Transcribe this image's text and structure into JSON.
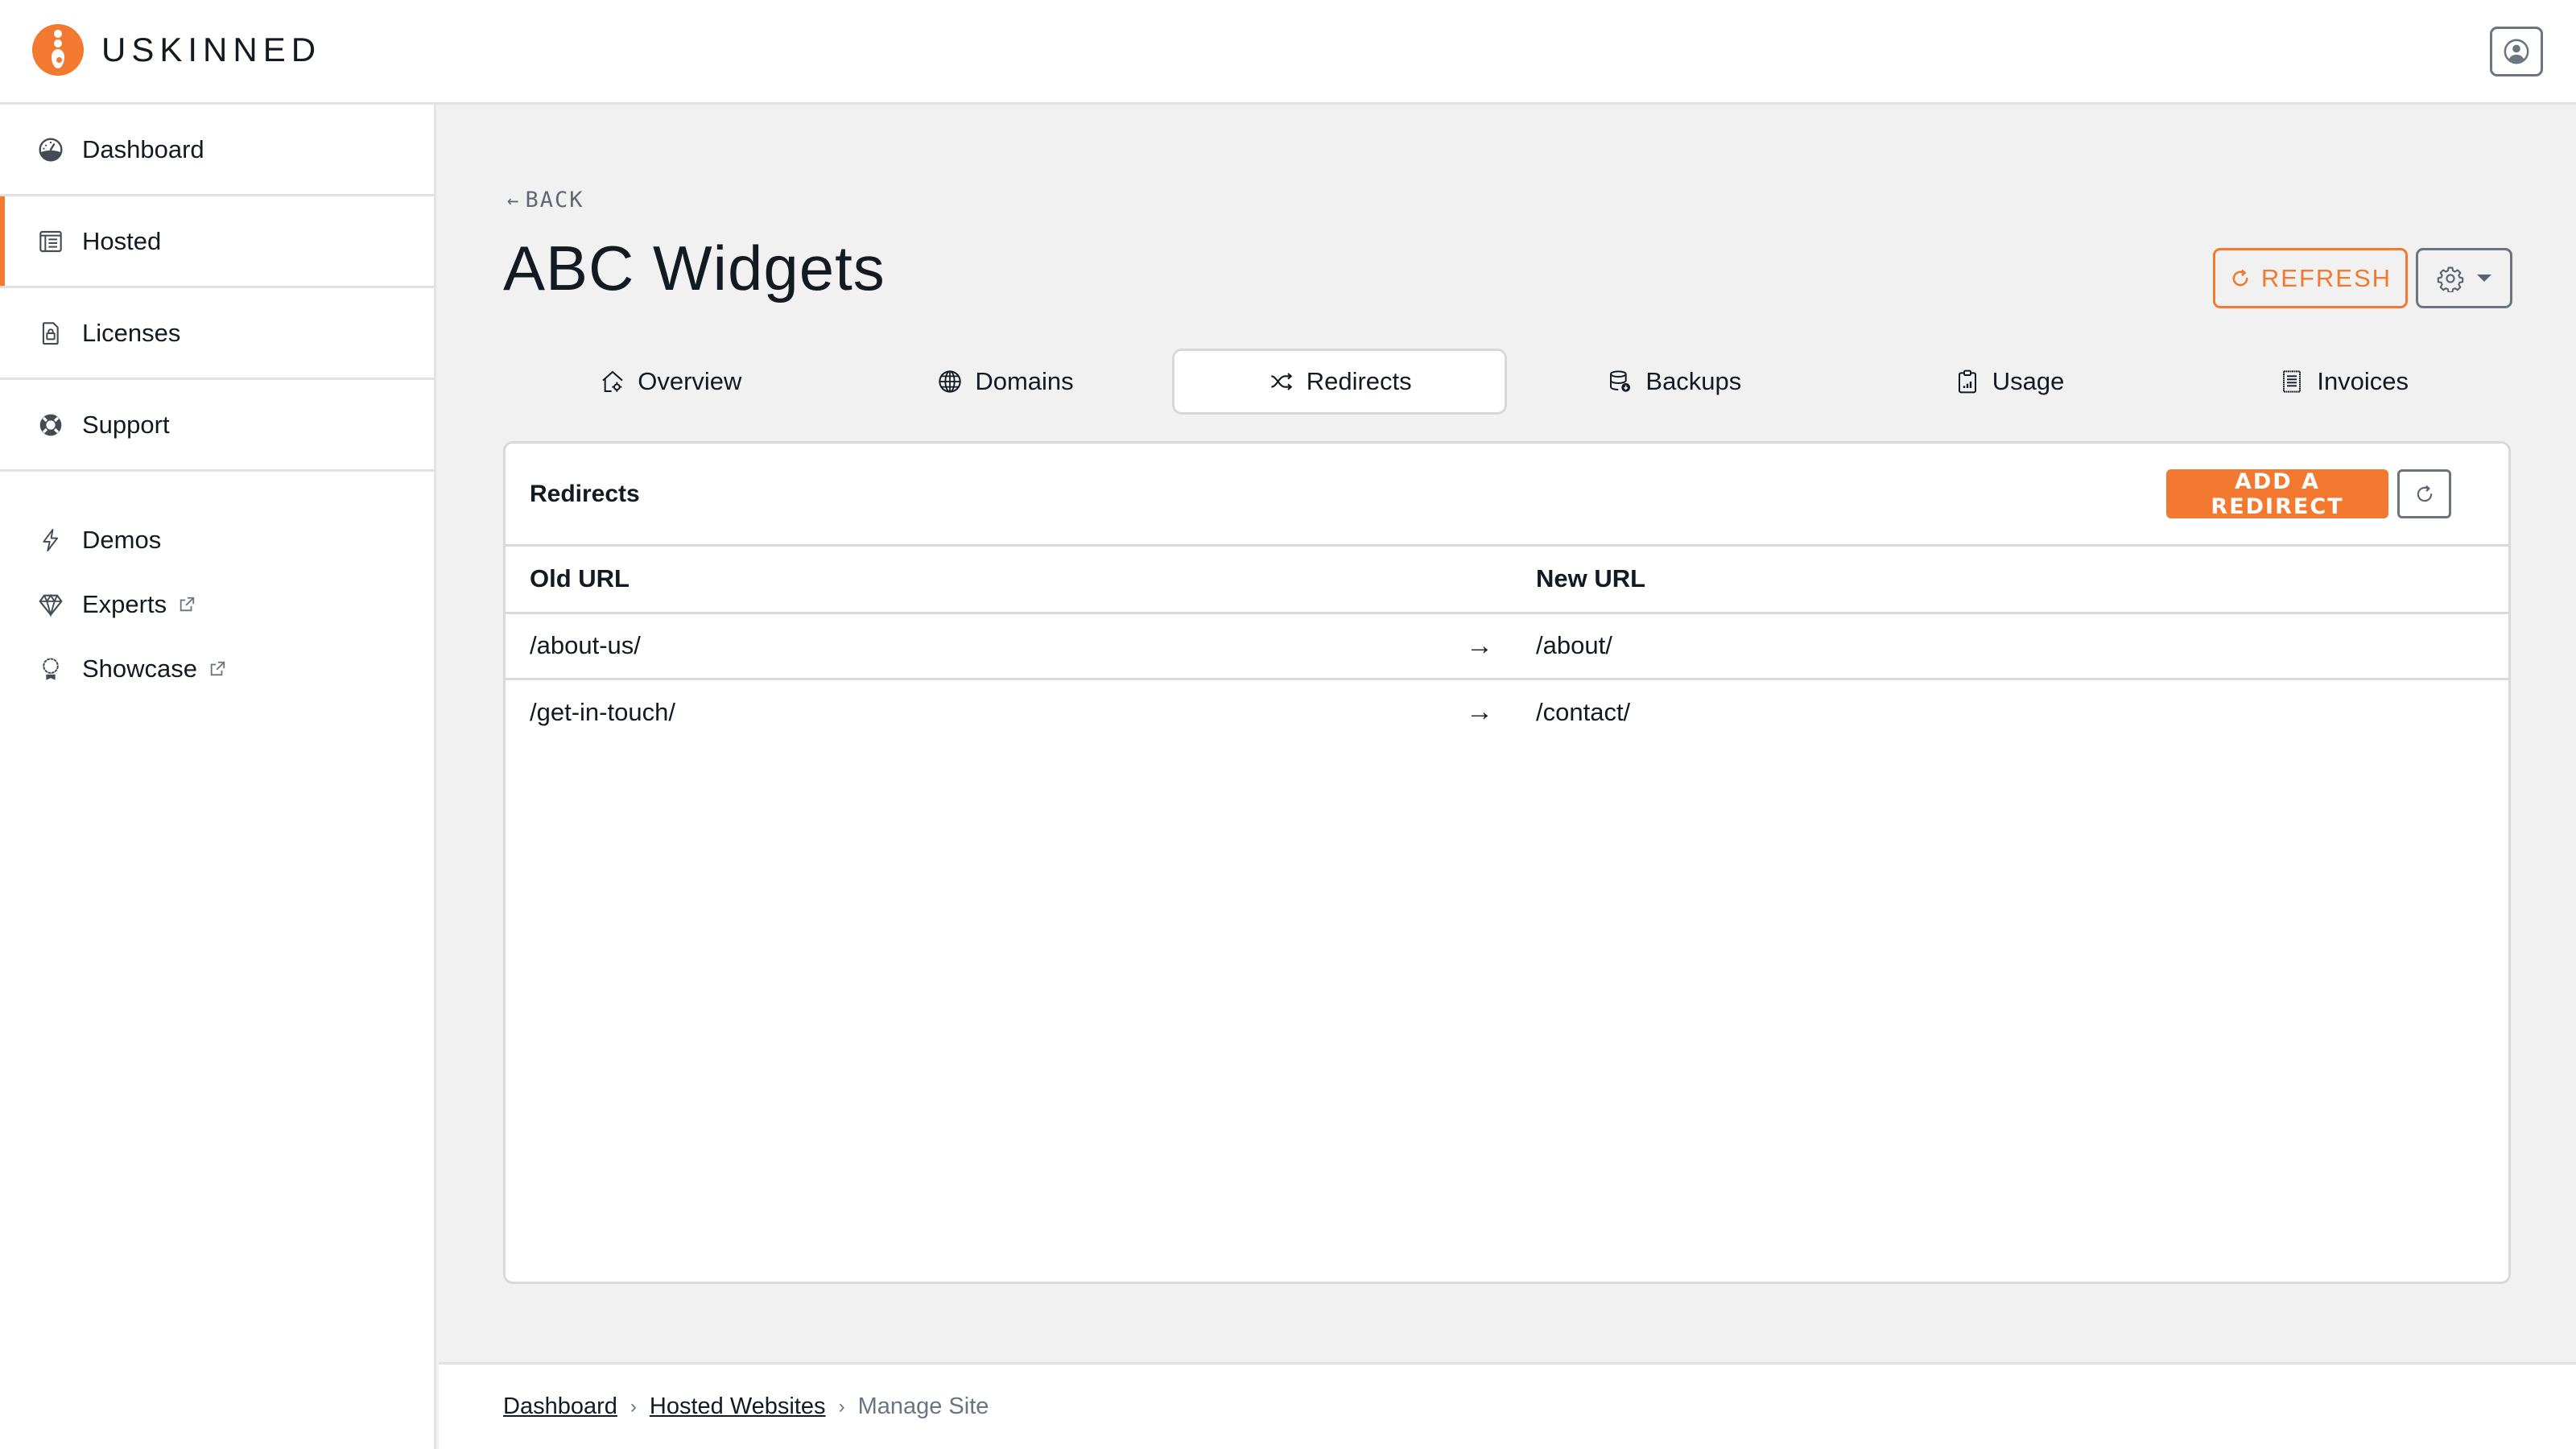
{
  "brand": {
    "name": "USKINNED",
    "accent_color": "#f2792f"
  },
  "header": {
    "account_icon": "user-circle-icon"
  },
  "sidebar": {
    "primary": [
      {
        "label": "Dashboard",
        "icon": "gauge-icon",
        "active": false
      },
      {
        "label": "Hosted",
        "icon": "hosted-list-icon",
        "active": true
      },
      {
        "label": "Licenses",
        "icon": "license-lock-icon",
        "active": false
      },
      {
        "label": "Support",
        "icon": "lifebuoy-icon",
        "active": false
      }
    ],
    "secondary": [
      {
        "label": "Demos",
        "icon": "lightning-icon",
        "external": false
      },
      {
        "label": "Experts",
        "icon": "diamond-icon",
        "external": true
      },
      {
        "label": "Showcase",
        "icon": "award-icon",
        "external": true
      }
    ]
  },
  "page": {
    "back_label": "BACK",
    "title": "ABC Widgets",
    "refresh_label": "REFRESH",
    "tabs": [
      {
        "label": "Overview",
        "icon": "home-gear-icon",
        "active": false
      },
      {
        "label": "Domains",
        "icon": "globe-icon",
        "active": false
      },
      {
        "label": "Redirects",
        "icon": "shuffle-icon",
        "active": true
      },
      {
        "label": "Backups",
        "icon": "database-icon",
        "active": false
      },
      {
        "label": "Usage",
        "icon": "clipboard-chart-icon",
        "active": false
      },
      {
        "label": "Invoices",
        "icon": "receipt-icon",
        "active": false
      }
    ]
  },
  "redirects": {
    "title": "Redirects",
    "add_label": "ADD A REDIRECT",
    "columns": {
      "old": "Old URL",
      "new": "New URL"
    },
    "arrow": "→",
    "rows": [
      {
        "old": "/about-us/",
        "new": "/about/"
      },
      {
        "old": "/get-in-touch/",
        "new": "/contact/"
      }
    ]
  },
  "breadcrumb": {
    "items": [
      {
        "label": "Dashboard",
        "link": true
      },
      {
        "label": "Hosted Websites",
        "link": true
      },
      {
        "label": "Manage Site",
        "link": false
      }
    ],
    "separator": "›"
  }
}
